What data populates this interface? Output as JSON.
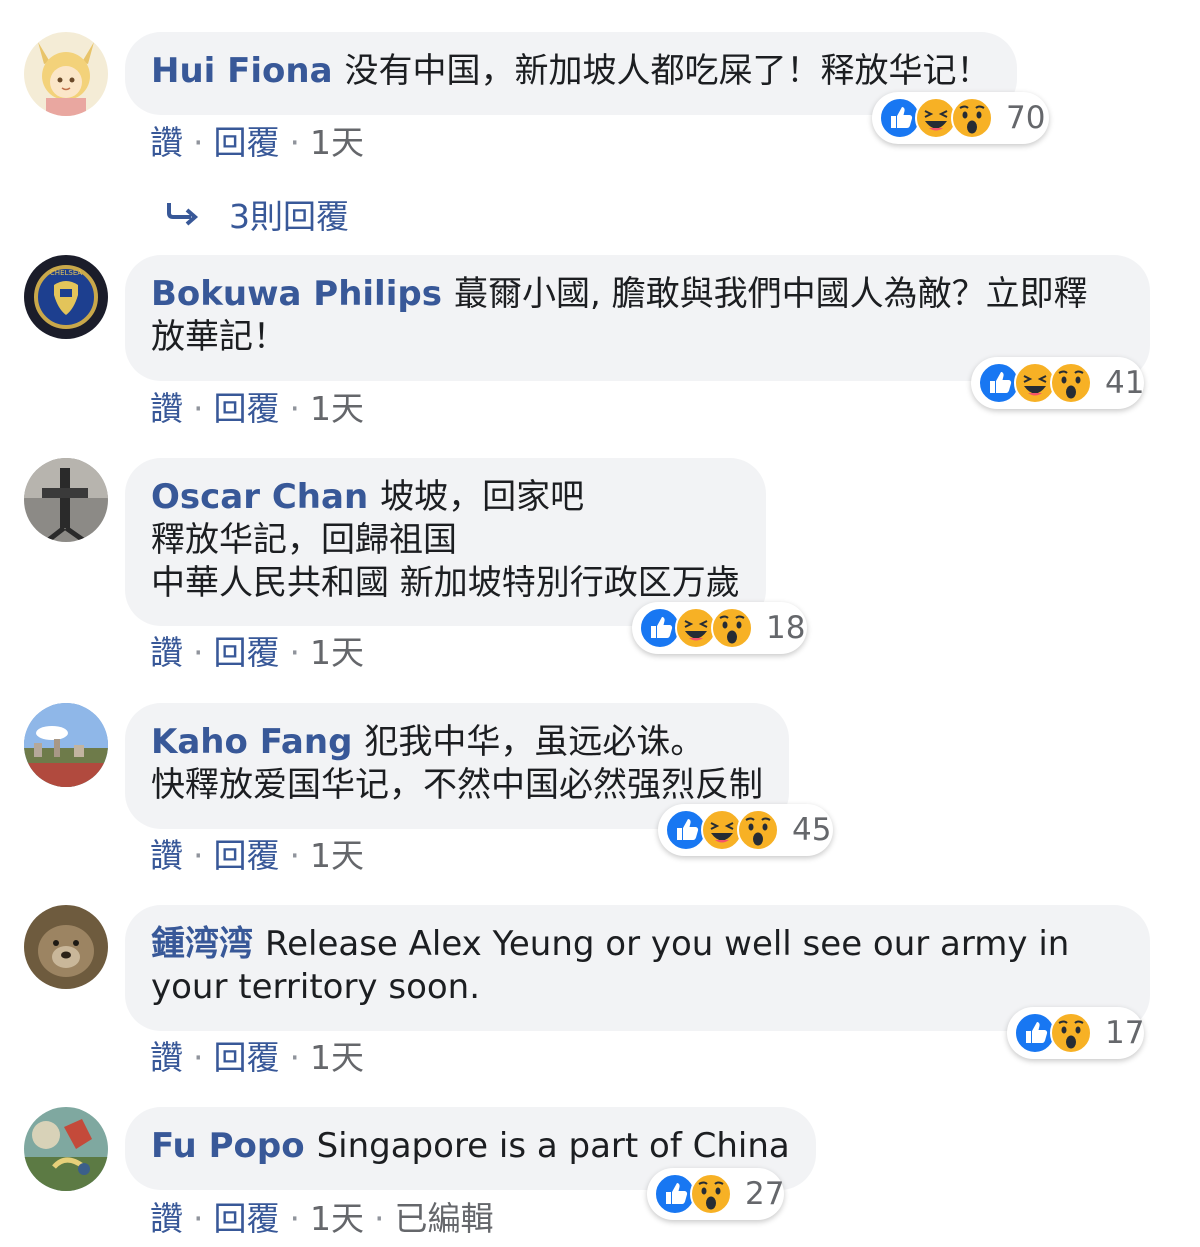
{
  "colors": {
    "author": "#385898",
    "bubble": "#f2f3f5",
    "like": "#1877f2",
    "emoji": "#f7b125"
  },
  "comments": [
    {
      "author": "Hui Fiona",
      "lines": [
        "没有中国，新加坡人都吃屎了！释放华记！"
      ],
      "reactions": [
        "like-icon",
        "haha-icon",
        "wow-icon"
      ],
      "count": "70",
      "like_label": "讚",
      "reply_label": "回覆",
      "time": "1天",
      "avatar": "anime-avatar"
    },
    {
      "author": "Bokuwa Philips",
      "lines": [
        "蕞爾小國, 膽敢與我們中國人為敵？立即釋",
        "放華記！"
      ],
      "reactions": [
        "like-icon",
        "haha-icon",
        "wow-icon"
      ],
      "count": "41",
      "like_label": "讚",
      "reply_label": "回覆",
      "time": "1天",
      "avatar": "crest-avatar"
    },
    {
      "author": "Oscar Chan",
      "lines": [
        "坡坡，回家吧",
        "釋放华記，回歸祖国",
        "中華人民共和國 新加坡特別行政区万歲"
      ],
      "reactions": [
        "like-icon",
        "haha-icon",
        "wow-icon"
      ],
      "count": "18",
      "like_label": "讚",
      "reply_label": "回覆",
      "time": "1天",
      "avatar": "tripod-avatar"
    },
    {
      "author": "Kaho Fang",
      "lines": [
        "犯我中华，虽远必诛。",
        "快釋放爱国华记，不然中国必然强烈反制"
      ],
      "reactions": [
        "like-icon",
        "haha-icon",
        "wow-icon"
      ],
      "count": "45",
      "like_label": "讚",
      "reply_label": "回覆",
      "time": "1天",
      "avatar": "landscape-avatar"
    },
    {
      "author": "鍾湾湾",
      "lines": [
        "Release Alex Yeung or you well see our army in",
        "your territory soon."
      ],
      "reactions": [
        "like-icon",
        "wow-icon"
      ],
      "count": "17",
      "like_label": "讚",
      "reply_label": "回覆",
      "time": "1天",
      "avatar": "animal-avatar"
    },
    {
      "author": "Fu Popo",
      "lines": [
        "Singapore is a part of China"
      ],
      "reactions": [
        "like-icon",
        "wow-icon"
      ],
      "count": "27",
      "like_label": "讚",
      "reply_label": "回覆",
      "time": "1天",
      "edited": "已編輯",
      "avatar": "painting-avatar"
    }
  ],
  "replies_link": {
    "label": "3則回覆",
    "icon": "reply-arrow-icon"
  }
}
